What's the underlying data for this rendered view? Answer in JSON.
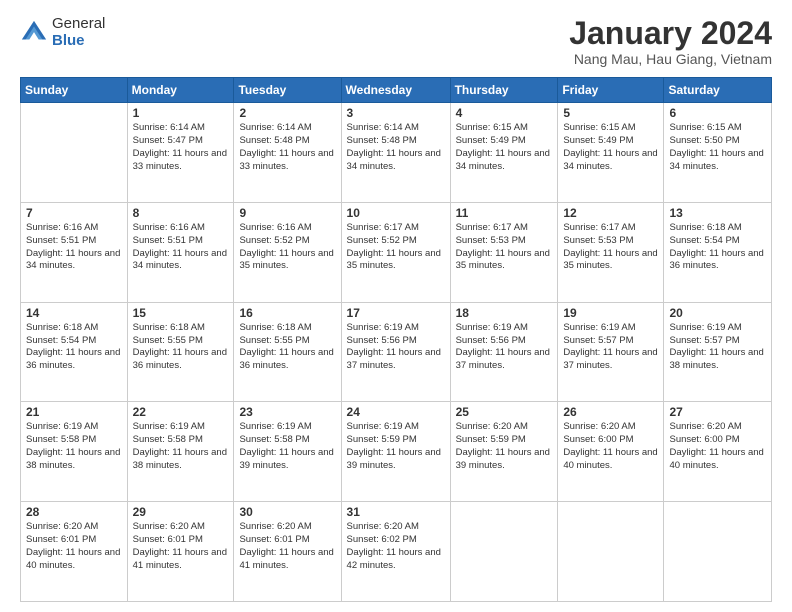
{
  "header": {
    "logo_general": "General",
    "logo_blue": "Blue",
    "month_title": "January 2024",
    "location": "Nang Mau, Hau Giang, Vietnam"
  },
  "days_of_week": [
    "Sunday",
    "Monday",
    "Tuesday",
    "Wednesday",
    "Thursday",
    "Friday",
    "Saturday"
  ],
  "weeks": [
    [
      {
        "day": "",
        "info": ""
      },
      {
        "day": "1",
        "info": "Sunrise: 6:14 AM\nSunset: 5:47 PM\nDaylight: 11 hours\nand 33 minutes."
      },
      {
        "day": "2",
        "info": "Sunrise: 6:14 AM\nSunset: 5:48 PM\nDaylight: 11 hours\nand 33 minutes."
      },
      {
        "day": "3",
        "info": "Sunrise: 6:14 AM\nSunset: 5:48 PM\nDaylight: 11 hours\nand 34 minutes."
      },
      {
        "day": "4",
        "info": "Sunrise: 6:15 AM\nSunset: 5:49 PM\nDaylight: 11 hours\nand 34 minutes."
      },
      {
        "day": "5",
        "info": "Sunrise: 6:15 AM\nSunset: 5:49 PM\nDaylight: 11 hours\nand 34 minutes."
      },
      {
        "day": "6",
        "info": "Sunrise: 6:15 AM\nSunset: 5:50 PM\nDaylight: 11 hours\nand 34 minutes."
      }
    ],
    [
      {
        "day": "7",
        "info": "Sunrise: 6:16 AM\nSunset: 5:51 PM\nDaylight: 11 hours\nand 34 minutes."
      },
      {
        "day": "8",
        "info": "Sunrise: 6:16 AM\nSunset: 5:51 PM\nDaylight: 11 hours\nand 34 minutes."
      },
      {
        "day": "9",
        "info": "Sunrise: 6:16 AM\nSunset: 5:52 PM\nDaylight: 11 hours\nand 35 minutes."
      },
      {
        "day": "10",
        "info": "Sunrise: 6:17 AM\nSunset: 5:52 PM\nDaylight: 11 hours\nand 35 minutes."
      },
      {
        "day": "11",
        "info": "Sunrise: 6:17 AM\nSunset: 5:53 PM\nDaylight: 11 hours\nand 35 minutes."
      },
      {
        "day": "12",
        "info": "Sunrise: 6:17 AM\nSunset: 5:53 PM\nDaylight: 11 hours\nand 35 minutes."
      },
      {
        "day": "13",
        "info": "Sunrise: 6:18 AM\nSunset: 5:54 PM\nDaylight: 11 hours\nand 36 minutes."
      }
    ],
    [
      {
        "day": "14",
        "info": "Sunrise: 6:18 AM\nSunset: 5:54 PM\nDaylight: 11 hours\nand 36 minutes."
      },
      {
        "day": "15",
        "info": "Sunrise: 6:18 AM\nSunset: 5:55 PM\nDaylight: 11 hours\nand 36 minutes."
      },
      {
        "day": "16",
        "info": "Sunrise: 6:18 AM\nSunset: 5:55 PM\nDaylight: 11 hours\nand 36 minutes."
      },
      {
        "day": "17",
        "info": "Sunrise: 6:19 AM\nSunset: 5:56 PM\nDaylight: 11 hours\nand 37 minutes."
      },
      {
        "day": "18",
        "info": "Sunrise: 6:19 AM\nSunset: 5:56 PM\nDaylight: 11 hours\nand 37 minutes."
      },
      {
        "day": "19",
        "info": "Sunrise: 6:19 AM\nSunset: 5:57 PM\nDaylight: 11 hours\nand 37 minutes."
      },
      {
        "day": "20",
        "info": "Sunrise: 6:19 AM\nSunset: 5:57 PM\nDaylight: 11 hours\nand 38 minutes."
      }
    ],
    [
      {
        "day": "21",
        "info": "Sunrise: 6:19 AM\nSunset: 5:58 PM\nDaylight: 11 hours\nand 38 minutes."
      },
      {
        "day": "22",
        "info": "Sunrise: 6:19 AM\nSunset: 5:58 PM\nDaylight: 11 hours\nand 38 minutes."
      },
      {
        "day": "23",
        "info": "Sunrise: 6:19 AM\nSunset: 5:58 PM\nDaylight: 11 hours\nand 39 minutes."
      },
      {
        "day": "24",
        "info": "Sunrise: 6:19 AM\nSunset: 5:59 PM\nDaylight: 11 hours\nand 39 minutes."
      },
      {
        "day": "25",
        "info": "Sunrise: 6:20 AM\nSunset: 5:59 PM\nDaylight: 11 hours\nand 39 minutes."
      },
      {
        "day": "26",
        "info": "Sunrise: 6:20 AM\nSunset: 6:00 PM\nDaylight: 11 hours\nand 40 minutes."
      },
      {
        "day": "27",
        "info": "Sunrise: 6:20 AM\nSunset: 6:00 PM\nDaylight: 11 hours\nand 40 minutes."
      }
    ],
    [
      {
        "day": "28",
        "info": "Sunrise: 6:20 AM\nSunset: 6:01 PM\nDaylight: 11 hours\nand 40 minutes."
      },
      {
        "day": "29",
        "info": "Sunrise: 6:20 AM\nSunset: 6:01 PM\nDaylight: 11 hours\nand 41 minutes."
      },
      {
        "day": "30",
        "info": "Sunrise: 6:20 AM\nSunset: 6:01 PM\nDaylight: 11 hours\nand 41 minutes."
      },
      {
        "day": "31",
        "info": "Sunrise: 6:20 AM\nSunset: 6:02 PM\nDaylight: 11 hours\nand 42 minutes."
      },
      {
        "day": "",
        "info": ""
      },
      {
        "day": "",
        "info": ""
      },
      {
        "day": "",
        "info": ""
      }
    ]
  ]
}
